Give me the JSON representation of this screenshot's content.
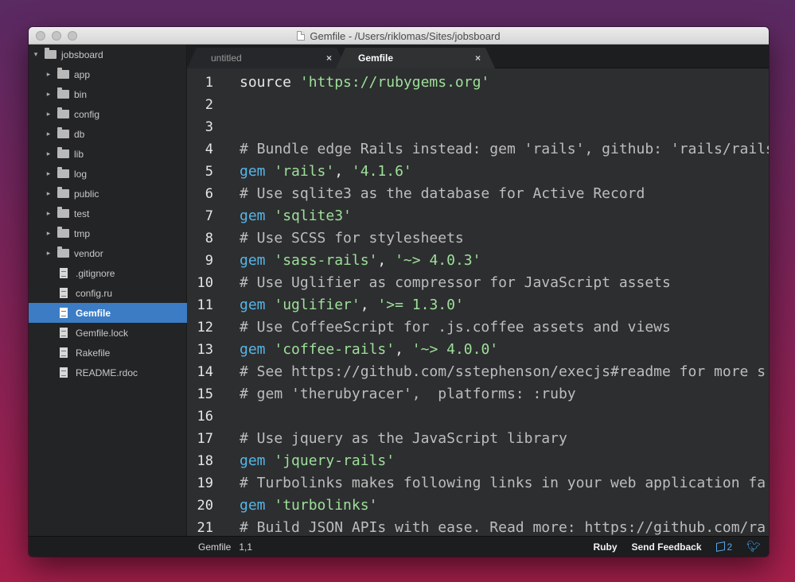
{
  "window": {
    "title": "Gemfile - /Users/riklomas/Sites/jobsboard"
  },
  "tree": [
    {
      "label": "jobsboard",
      "type": "root"
    },
    {
      "label": "app",
      "type": "folder"
    },
    {
      "label": "bin",
      "type": "folder"
    },
    {
      "label": "config",
      "type": "folder"
    },
    {
      "label": "db",
      "type": "folder"
    },
    {
      "label": "lib",
      "type": "folder"
    },
    {
      "label": "log",
      "type": "folder"
    },
    {
      "label": "public",
      "type": "folder"
    },
    {
      "label": "test",
      "type": "folder"
    },
    {
      "label": "tmp",
      "type": "folder"
    },
    {
      "label": "vendor",
      "type": "folder"
    },
    {
      "label": ".gitignore",
      "type": "file"
    },
    {
      "label": "config.ru",
      "type": "file"
    },
    {
      "label": "Gemfile",
      "type": "file",
      "selected": true
    },
    {
      "label": "Gemfile.lock",
      "type": "file"
    },
    {
      "label": "Rakefile",
      "type": "file"
    },
    {
      "label": "README.rdoc",
      "type": "file"
    }
  ],
  "tabs": [
    {
      "label": "untitled",
      "close": "×",
      "active": false
    },
    {
      "label": "Gemfile",
      "close": "×",
      "active": true
    }
  ],
  "code": [
    {
      "n": "1",
      "tokens": [
        [
          "kw",
          "source "
        ],
        [
          "str",
          "'https://rubygems.org'"
        ]
      ]
    },
    {
      "n": "2",
      "tokens": []
    },
    {
      "n": "3",
      "tokens": []
    },
    {
      "n": "4",
      "tokens": [
        [
          "cm",
          "# Bundle edge Rails instead: gem 'rails', github: 'rails/rails'"
        ]
      ]
    },
    {
      "n": "5",
      "tokens": [
        [
          "gem",
          "gem "
        ],
        [
          "str",
          "'rails'"
        ],
        [
          "pn",
          ", "
        ],
        [
          "str",
          "'4.1.6'"
        ]
      ]
    },
    {
      "n": "6",
      "tokens": [
        [
          "cm",
          "# Use sqlite3 as the database for Active Record"
        ]
      ]
    },
    {
      "n": "7",
      "tokens": [
        [
          "gem",
          "gem "
        ],
        [
          "str",
          "'sqlite3'"
        ]
      ]
    },
    {
      "n": "8",
      "tokens": [
        [
          "cm",
          "# Use SCSS for stylesheets"
        ]
      ]
    },
    {
      "n": "9",
      "tokens": [
        [
          "gem",
          "gem "
        ],
        [
          "str",
          "'sass-rails'"
        ],
        [
          "pn",
          ", "
        ],
        [
          "str",
          "'~> 4.0.3'"
        ]
      ]
    },
    {
      "n": "10",
      "tokens": [
        [
          "cm",
          "# Use Uglifier as compressor for JavaScript assets"
        ]
      ]
    },
    {
      "n": "11",
      "tokens": [
        [
          "gem",
          "gem "
        ],
        [
          "str",
          "'uglifier'"
        ],
        [
          "pn",
          ", "
        ],
        [
          "str",
          "'>= 1.3.0'"
        ]
      ]
    },
    {
      "n": "12",
      "tokens": [
        [
          "cm",
          "# Use CoffeeScript for .js.coffee assets and views"
        ]
      ]
    },
    {
      "n": "13",
      "tokens": [
        [
          "gem",
          "gem "
        ],
        [
          "str",
          "'coffee-rails'"
        ],
        [
          "pn",
          ", "
        ],
        [
          "str",
          "'~> 4.0.0'"
        ]
      ]
    },
    {
      "n": "14",
      "tokens": [
        [
          "cm",
          "# See https://github.com/sstephenson/execjs#readme for more s"
        ]
      ]
    },
    {
      "n": "15",
      "tokens": [
        [
          "cm",
          "# gem 'therubyracer',  platforms: :ruby"
        ]
      ]
    },
    {
      "n": "16",
      "tokens": []
    },
    {
      "n": "17",
      "tokens": [
        [
          "cm",
          "# Use jquery as the JavaScript library"
        ]
      ]
    },
    {
      "n": "18",
      "tokens": [
        [
          "gem",
          "gem "
        ],
        [
          "str",
          "'jquery-rails'"
        ]
      ]
    },
    {
      "n": "19",
      "tokens": [
        [
          "cm",
          "# Turbolinks makes following links in your web application fa"
        ]
      ]
    },
    {
      "n": "20",
      "tokens": [
        [
          "gem",
          "gem "
        ],
        [
          "str",
          "'turbolinks'"
        ]
      ]
    },
    {
      "n": "21",
      "tokens": [
        [
          "cm",
          "# Build JSON APIs with ease. Read more: https://github.com/ra"
        ]
      ]
    }
  ],
  "status": {
    "file": "Gemfile",
    "cursor": "1,1",
    "grammar": "Ruby",
    "feedback": "Send Feedback",
    "packages": "2"
  }
}
